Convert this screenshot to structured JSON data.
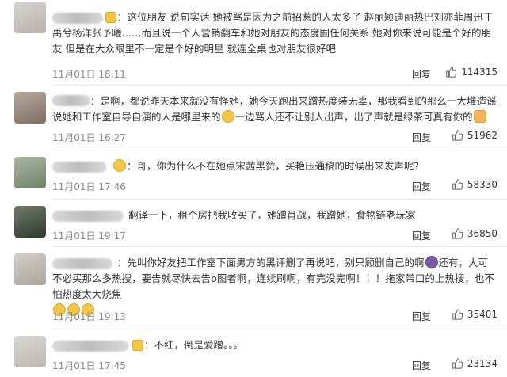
{
  "comments": [
    {
      "lead": "：这位朋友 说句实话 她被骂是因为之前招惹的人太多了 赵丽颖迪丽热巴刘亦菲周迅丁禹兮杨洋张予曦……而且说一个人营销翻车和她对朋友的态度囿任何关系 她对你来说可能是个好的朋友 但是在大众眼里不一定是个好的明星 就连全桌也对朋友很好吧",
      "date": "11月01日 18:11",
      "reply": "回复",
      "likes": "114315"
    },
    {
      "lead": "：是啊，都说昨天本来就没有怪她，她今天跑出来蹭热度装无辜，那我看到的那么一大堆造谣说她和工作室自导自演的人是哪里来的",
      "tail": "一边骂人还不让别人出声，出了声就是绿茶可真有你的",
      "date": "11月01日 16:27",
      "reply": "回复",
      "likes": "51962"
    },
    {
      "lead": "：哥，你为什么不在她点宋茜黑赞，买艳压通稿的时候出来发声呢？",
      "date": "11月01日 17:46",
      "reply": "回复",
      "likes": "58330"
    },
    {
      "lead": "翻译一下，租个房把我收买了，她蹭肖战，我蹭她，食物链老玩家",
      "date": "11月01日 19:17",
      "reply": "回复",
      "likes": "36850"
    },
    {
      "lead": "：先叫你好友把工作室下面男方的黑评删了再说吧，别只顾删自己的啊",
      "mid": "还有，大可不必买那么多热搜，要告就尽快去告p图者啊，连续刷啊，有完没完啊！！！拖家带口的上热搜，也不怕热度太大烧焦",
      "date": "11月01日 19:13",
      "reply": "回复",
      "likes": "35401"
    },
    {
      "lead": "：不红，倒是爱蹭。。。",
      "date": "11月01日 17:45",
      "reply": "回复",
      "likes": "23134"
    }
  ]
}
